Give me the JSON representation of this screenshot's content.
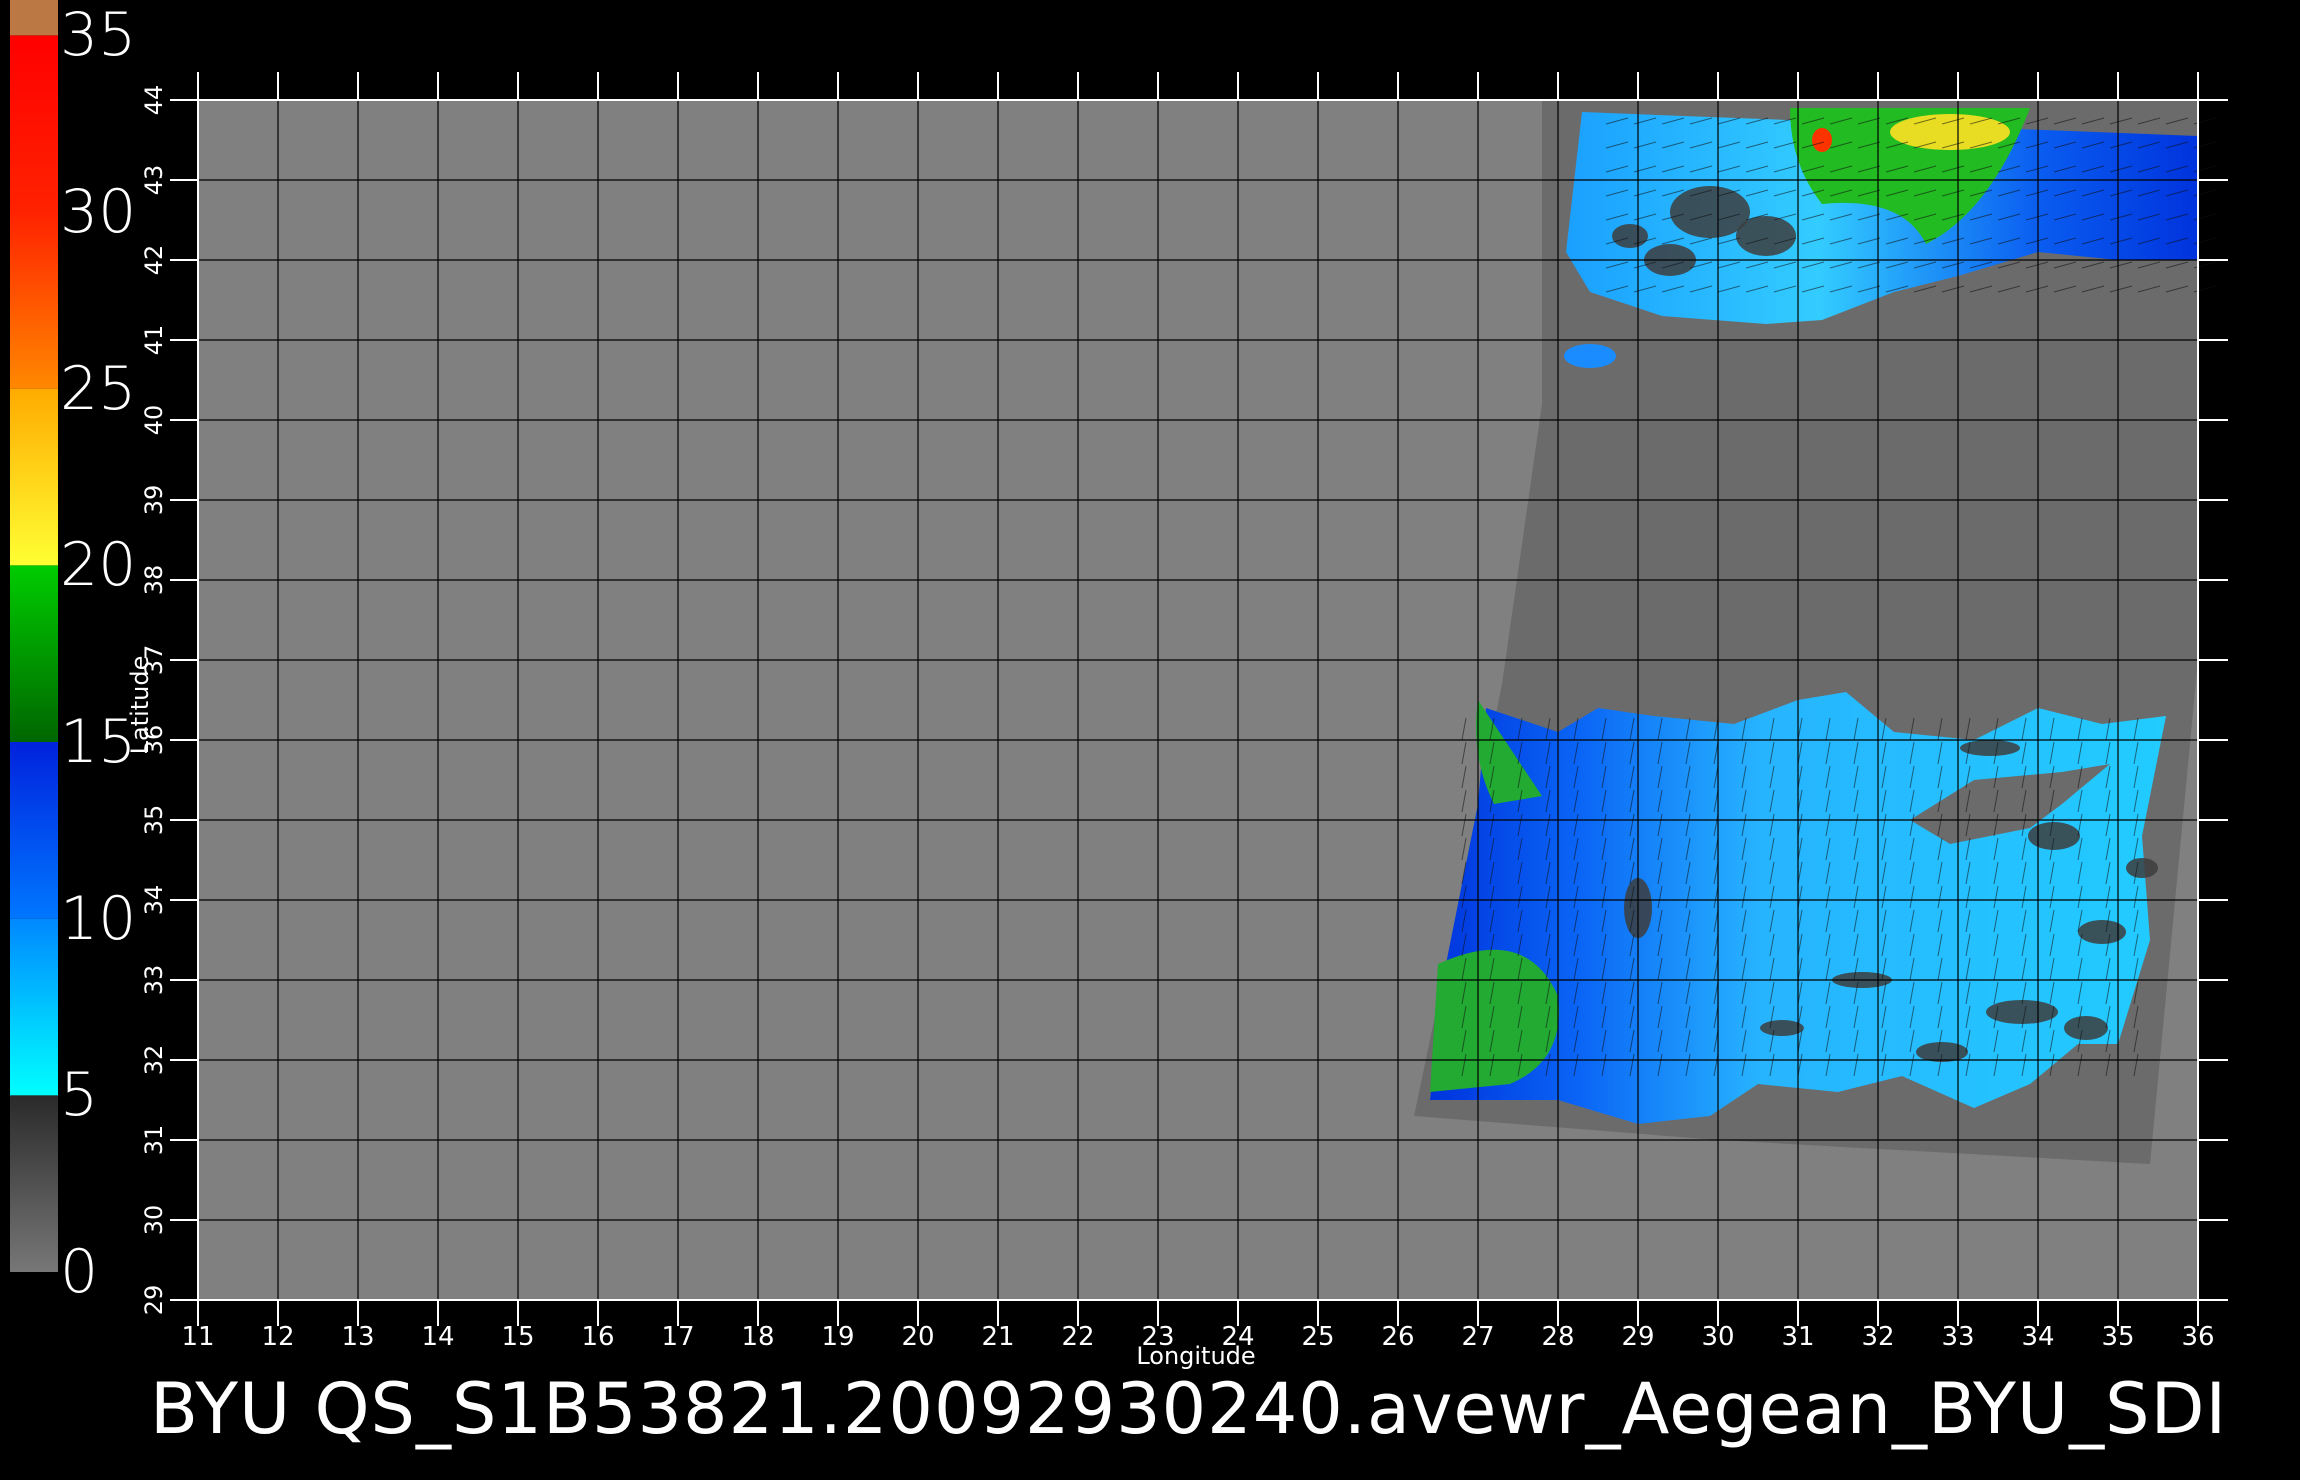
{
  "colorbar": {
    "labels": [
      "35",
      "30",
      "25",
      "20",
      "15",
      "10",
      "5",
      "0"
    ],
    "bands": [
      {
        "from": 0,
        "to": 5,
        "colors": [
          "#777777",
          "#2a2a2a"
        ]
      },
      {
        "from": 5,
        "to": 10,
        "colors": [
          "#00ffff",
          "#0088ff"
        ]
      },
      {
        "from": 10,
        "to": 15,
        "colors": [
          "#0077ff",
          "#0022dd"
        ]
      },
      {
        "from": 15,
        "to": 20,
        "colors": [
          "#006600",
          "#00cc00"
        ]
      },
      {
        "from": 20,
        "to": 25,
        "colors": [
          "#ffff33",
          "#ffaa00"
        ]
      },
      {
        "from": 25,
        "to": 30,
        "colors": [
          "#ff8800",
          "#ff2200"
        ]
      },
      {
        "from": 30,
        "to": 35,
        "colors": [
          "#ff2200",
          "#ff0000"
        ]
      },
      {
        "from": 35,
        "to": 36,
        "colors": [
          "#bb7744",
          "#bb7744"
        ]
      }
    ]
  },
  "axes": {
    "x_label": "Longitude",
    "y_label": "Latitude",
    "x_ticks": [
      "11",
      "12",
      "13",
      "14",
      "15",
      "16",
      "17",
      "18",
      "19",
      "20",
      "21",
      "22",
      "23",
      "24",
      "25",
      "26",
      "27",
      "28",
      "29",
      "30",
      "31",
      "32",
      "33",
      "34",
      "35",
      "36"
    ],
    "y_ticks": [
      "29",
      "30",
      "31",
      "32",
      "33",
      "34",
      "35",
      "36",
      "37",
      "38",
      "39",
      "40",
      "41",
      "42",
      "43",
      "44"
    ],
    "lon_range": [
      11,
      36
    ],
    "lat_range": [
      29,
      44
    ]
  },
  "colors": {
    "background": "#000000",
    "no_data": "#808080",
    "land": "#6b6b6b",
    "land_edge": "#474747",
    "grid": "#000000"
  },
  "title": "BYU  QS_S1B53821.20092930240.avewr_Aegean_BYU_SDI"
}
